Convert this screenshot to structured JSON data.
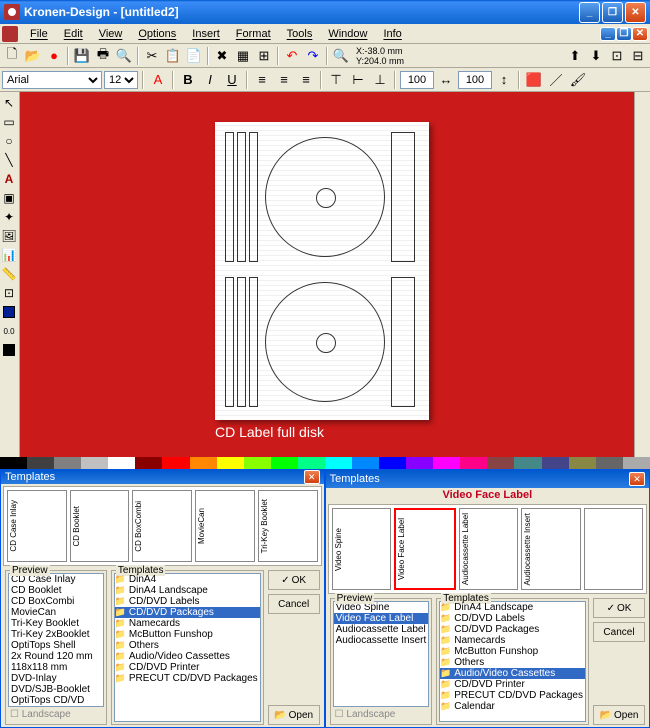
{
  "window": {
    "title": "Kronen-Design - [untitled2]"
  },
  "menu": {
    "file": "File",
    "edit": "Edit",
    "view": "View",
    "options": "Options",
    "insert": "Insert",
    "format": "Format",
    "tools": "Tools",
    "window": "Window",
    "info": "Info"
  },
  "coords": {
    "x": "X:-38.0 mm",
    "y": "Y:204.0 mm"
  },
  "font": {
    "name": "Arial",
    "size": "12",
    "pct1": "100",
    "pct2": "100"
  },
  "canvas": {
    "caption": "CD Label full disk"
  },
  "dialog1": {
    "title": "Templates",
    "thumblabels": [
      "CD Case Inlay",
      "CD Booklet",
      "CD BoxCombi",
      "MovieCan",
      "Tri-Key Booklet"
    ],
    "preview_legend": "Preview",
    "templates_legend": "Templates",
    "preview_items": [
      "CD Case Inlay",
      "CD Booklet",
      "CD BoxCombi",
      "MovieCan",
      "Tri-Key Booklet",
      "Tri-Key 2xBooklet",
      "OptiTops Shell",
      "2x Round 120 mm",
      "118x118 mm",
      "DVD-Inlay",
      "DVD/SJB-Booklet",
      "OptiTops CD/VD"
    ],
    "tree_items": [
      {
        "label": "DinA4"
      },
      {
        "label": "DinA4 Landscape"
      },
      {
        "label": "CD/DVD Labels"
      },
      {
        "label": "CD/DVD Packages",
        "sel": true
      },
      {
        "label": "Namecards"
      },
      {
        "label": "McButton Funshop"
      },
      {
        "label": "Others"
      },
      {
        "label": "Audio/Video Cassettes"
      },
      {
        "label": "CD/DVD Printer"
      },
      {
        "label": "PRECUT CD/DVD Packages"
      }
    ],
    "ok": "OK",
    "cancel": "Cancel",
    "open": "Open",
    "landscape": "Landscape"
  },
  "dialog2": {
    "title": "Templates",
    "redtitle": "Video Face Label",
    "thumblabels": [
      "Video Spine",
      "Video Face Label",
      "Audiocassette Label",
      "Audiocassette Insert",
      ""
    ],
    "preview_legend": "Preview",
    "templates_legend": "Templates",
    "preview_items": [
      "Video Spine",
      "Video Face Label",
      "Audiocassette Label",
      "Audiocassette Insert"
    ],
    "preview_sel": 1,
    "tree_items": [
      {
        "label": "DinA4 Landscape"
      },
      {
        "label": "CD/DVD Labels"
      },
      {
        "label": "CD/DVD Packages"
      },
      {
        "label": "Namecards"
      },
      {
        "label": "McButton Funshop"
      },
      {
        "label": "Others"
      },
      {
        "label": "Audio/Video Cassettes",
        "sel": true
      },
      {
        "label": "CD/DVD Printer"
      },
      {
        "label": "PRECUT CD/DVD Packages"
      },
      {
        "label": "Calendar"
      }
    ],
    "ok": "OK",
    "cancel": "Cancel",
    "open": "Open",
    "landscape": "Landscape"
  },
  "colors": {
    "accent": "#0054e3",
    "canvas": "#ca1a1a"
  }
}
